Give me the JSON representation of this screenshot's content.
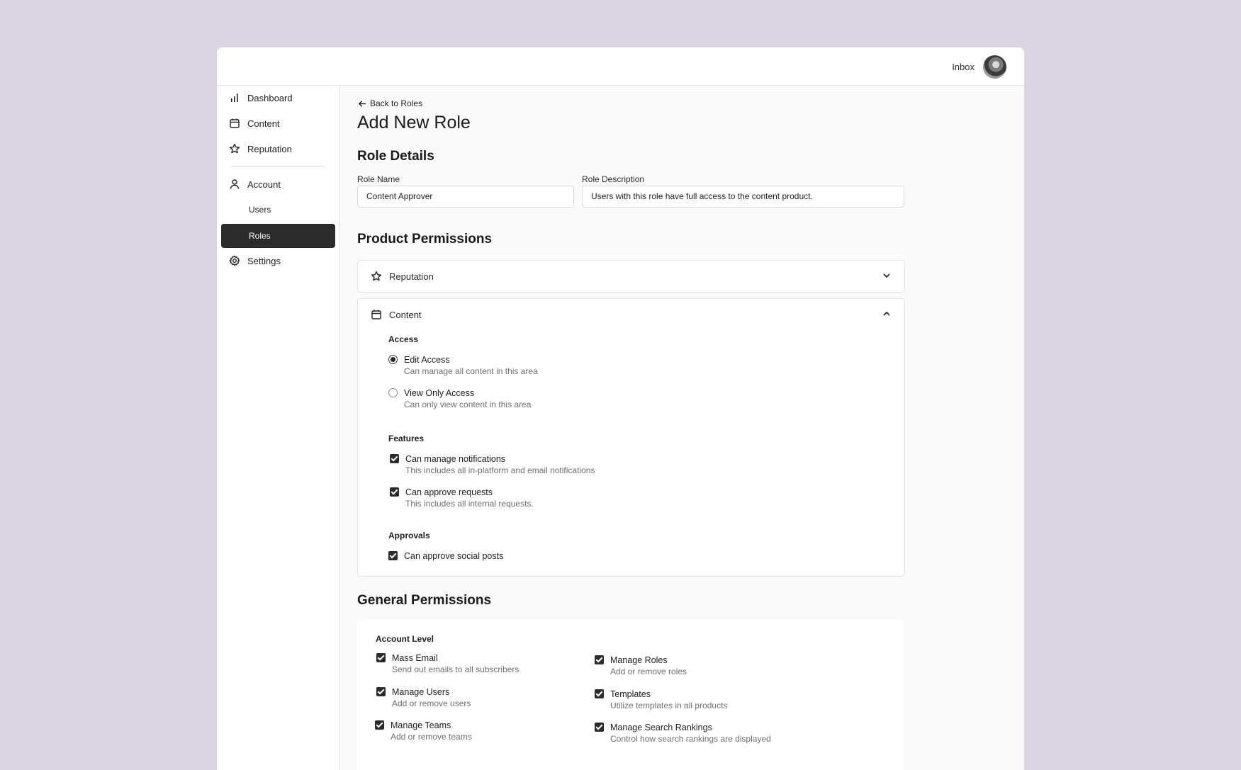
{
  "header": {
    "inbox_label": "Inbox",
    "avatar_alt": ""
  },
  "sidebar": {
    "items": [
      {
        "label": "Dashboard",
        "icon": "bar-chart-icon"
      },
      {
        "label": "Content",
        "icon": "calendar-icon"
      },
      {
        "label": "Reputation",
        "icon": "star-icon"
      },
      {
        "label": "Account",
        "icon": "user-icon"
      },
      {
        "label": "Users",
        "icon": ""
      },
      {
        "label": "Roles",
        "icon": "",
        "active": true
      },
      {
        "label": "Settings",
        "icon": "gear-icon"
      }
    ]
  },
  "main": {
    "back_label": "Back to Roles",
    "title": "Add New Role",
    "role_details": {
      "heading": "Role Details",
      "name_label": "Role Name",
      "name_value": "Content Approver",
      "description_label": "Role Description",
      "description_value": "Users with this role have full access to the content product."
    },
    "product_permissions": {
      "heading": "Product Permissions",
      "reputation": {
        "label": "Reputation",
        "expanded": false
      },
      "content": {
        "label": "Content",
        "expanded": true,
        "access": {
          "title": "Access",
          "options": [
            {
              "label": "Edit Access",
              "description": "Can manage all content in this area",
              "selected": true
            },
            {
              "label": "View Only Access",
              "description": "Can only view content in this area",
              "selected": false
            }
          ]
        },
        "features": {
          "title": "Features",
          "options": [
            {
              "label": "Can manage notifications",
              "description": "This includes all in-platform and email notifications",
              "checked": true
            },
            {
              "label": "Can approve requests",
              "description": "This includes all internal requests.",
              "checked": true
            }
          ]
        },
        "approvals": {
          "title": "Approvals",
          "options": [
            {
              "label": "Can approve social posts",
              "checked": true
            }
          ]
        }
      }
    },
    "general_permissions": {
      "heading": "General Permissions",
      "account_level": {
        "title": "Account Level",
        "left": [
          {
            "label": "Mass Email",
            "description": "Send out emails to all subscribers",
            "checked": true
          },
          {
            "label": "Manage Users",
            "description": "Add or remove users",
            "checked": true
          },
          {
            "label": "Manage Teams",
            "description": "Add or remove teams",
            "checked": true
          }
        ],
        "right": [
          {
            "label": "Manage Roles",
            "description": "Add or remove roles",
            "checked": true
          },
          {
            "label": "Templates",
            "description": "Utilize templates in all products",
            "checked": true
          },
          {
            "label": "Manage Search Rankings",
            "description": "Control how search rankings are displayed",
            "checked": true
          }
        ]
      }
    }
  },
  "colors": {
    "background": "#dad5e1",
    "active_nav": "#2b2b2b",
    "checkbox": "#2b2b2b"
  }
}
